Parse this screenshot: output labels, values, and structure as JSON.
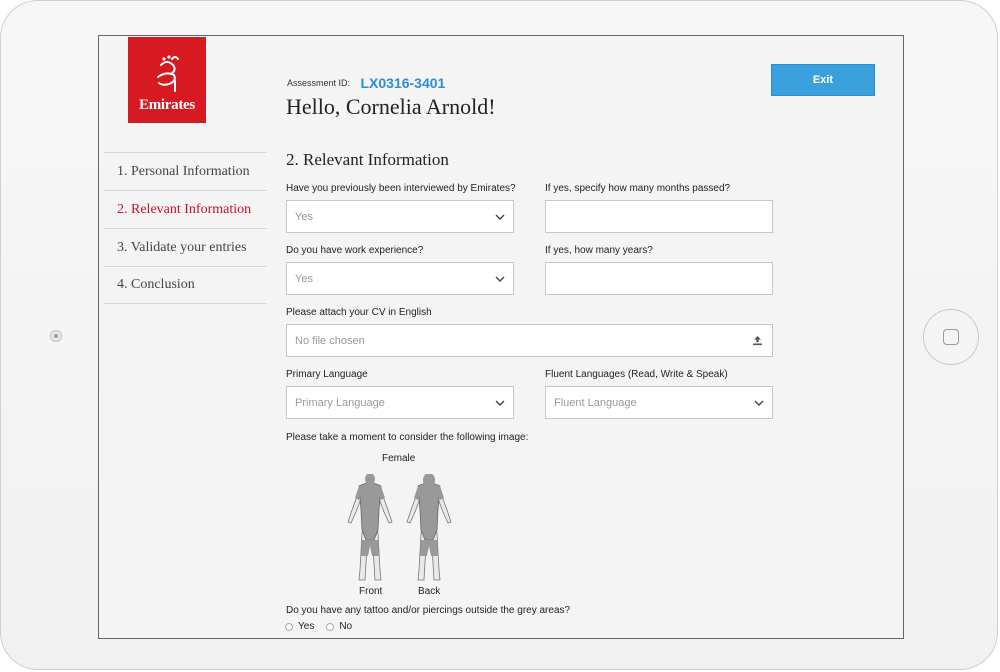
{
  "header": {
    "logo_text": "Emirates",
    "assessment_label": "Assessment ID:",
    "assessment_id": "LX0316-3401",
    "greeting": "Hello, Cornelia Arnold!",
    "exit_label": "Exit"
  },
  "sidebar": {
    "items": [
      {
        "label": "1. Personal Information"
      },
      {
        "label": "2. Relevant Information"
      },
      {
        "label": "3. Validate your entries"
      },
      {
        "label": "4. Conclusion"
      }
    ],
    "active_index": 1
  },
  "form": {
    "section_title": "2. Relevant Information",
    "interviewed_label": "Have you previously been interviewed by Emirates?",
    "interviewed_value": "Yes",
    "months_label": "If yes, specify how many months passed?",
    "months_value": "",
    "work_label": "Do you have work experience?",
    "work_value": "Yes",
    "years_label": "If yes, how many years?",
    "years_value": "",
    "cv_label": "Please attach your CV in English",
    "cv_value": "No file chosen",
    "primary_lang_label": "Primary Language",
    "primary_lang_placeholder": "Primary Language",
    "fluent_lang_label": "Fluent Languages (Read, Write & Speak)",
    "fluent_lang_placeholder": "Fluent Language",
    "image_prompt": "Please take a moment to consider the following image:",
    "figure_title": "Female",
    "front_label": "Front",
    "back_label": "Back",
    "tattoo_question": "Do you have any tattoo and/or piercings outside the grey areas?",
    "options": {
      "yes": "Yes",
      "no": "No"
    }
  },
  "colors": {
    "brand_red": "#d71921",
    "accent_blue": "#3aa0dd",
    "active_nav": "#c8102e"
  },
  "icons": [
    "emirates-logo-icon",
    "chevron-down-icon",
    "upload-icon",
    "camera-icon",
    "home-button-icon"
  ]
}
